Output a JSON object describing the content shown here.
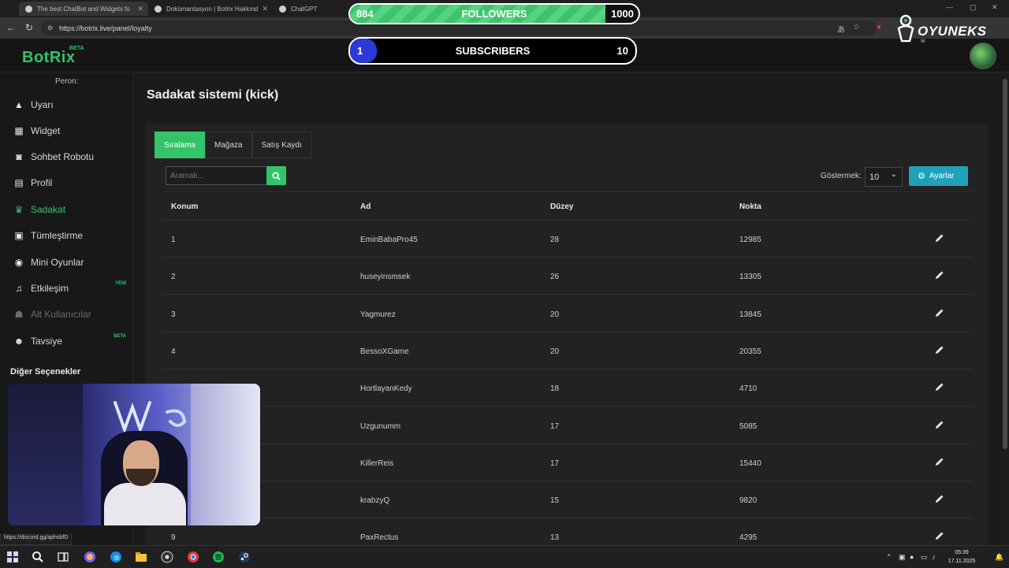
{
  "browser": {
    "tabs": [
      {
        "title": "The best ChatBot and Widgets fo"
      },
      {
        "title": "Dokümantasyon | Botrix Hakkınd"
      },
      {
        "title": "ChatGPT"
      }
    ],
    "url": "https://botrix.live/panel/loyalty"
  },
  "overlay": {
    "followers": {
      "label": "FOLLOWERS",
      "current": "884",
      "goal": "1000",
      "progress": 0.884
    },
    "subscribers": {
      "label": "SUBSCRIBERS",
      "current": "1",
      "goal": "10",
      "progress": 0.1
    },
    "brand": "OYUNEKS",
    "brand_sub": "W"
  },
  "app": {
    "logo": "BotRix",
    "logo_badge": "BETA",
    "user_label": "Peron:",
    "page_title": "Sadakat sistemi (kick)",
    "accent": "#33c46a"
  },
  "sidebar": {
    "items": [
      {
        "label": "Uyarı",
        "icon": "warning-icon"
      },
      {
        "label": "Widget",
        "icon": "grid-icon"
      },
      {
        "label": "Sohbet Robotu",
        "icon": "robot-icon"
      },
      {
        "label": "Profil",
        "icon": "id-card-icon"
      },
      {
        "label": "Sadakat",
        "icon": "trophy-icon",
        "active": true
      },
      {
        "label": "Tümleştirme",
        "icon": "plug-icon"
      },
      {
        "label": "Mini Oyunlar",
        "icon": "gamepad-icon"
      },
      {
        "label": "Etkileşim",
        "icon": "music-icon",
        "badge": "YENİ"
      },
      {
        "label": "Alt Kullanıcılar",
        "icon": "users-icon",
        "disabled": true
      },
      {
        "label": "Tavsiye",
        "icon": "user-group-icon",
        "badge": "BETA"
      }
    ],
    "section": "Diğer Seçenekler"
  },
  "tabs": [
    "Sıralama",
    "Mağaza",
    "Satış Kaydı"
  ],
  "search": {
    "placeholder": "Aramak..."
  },
  "show": {
    "label": "Göstermek:",
    "value": "10"
  },
  "settings_button": "Ayarlar",
  "table": {
    "headers": [
      "Konum",
      "Ad",
      "Düzey",
      "Nokta"
    ],
    "rows": [
      {
        "pos": "1",
        "name": "EminBabaPro45",
        "level": "28",
        "points": "12985"
      },
      {
        "pos": "2",
        "name": "huseyinsmsek",
        "level": "26",
        "points": "13305"
      },
      {
        "pos": "3",
        "name": "Yagmurez",
        "level": "20",
        "points": "13845"
      },
      {
        "pos": "4",
        "name": "BessoXGame",
        "level": "20",
        "points": "20355"
      },
      {
        "pos": "",
        "name": "HortlayanKedy",
        "level": "18",
        "points": "4710"
      },
      {
        "pos": "",
        "name": "Uzgunumm",
        "level": "17",
        "points": "5085"
      },
      {
        "pos": "",
        "name": "KillerReis",
        "level": "17",
        "points": "15440"
      },
      {
        "pos": "",
        "name": "krabzyQ",
        "level": "15",
        "points": "9820"
      },
      {
        "pos": "9",
        "name": "PaxRectus",
        "level": "13",
        "points": "4295"
      }
    ]
  },
  "status_url": "https://discord.gg/aphsbfD",
  "clock": {
    "time": "05:39",
    "date": "17.11.2025"
  }
}
